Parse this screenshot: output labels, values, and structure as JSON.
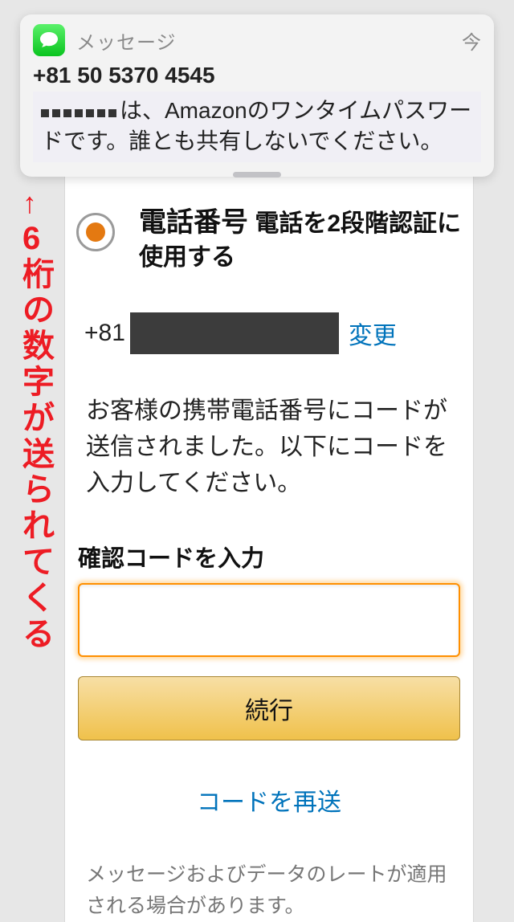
{
  "notification": {
    "app_name": "メッセージ",
    "time": "今",
    "from": "+81 50 5370 4545",
    "body_after_mask": "は、Amazonのワンタイムパスワードです。誰とも共有しないでください。"
  },
  "form": {
    "radio_label_bold": "電話番号",
    "radio_label_rest": " 電話を2段階認証に使用する",
    "phone_prefix": "+81",
    "change_link": "変更",
    "instruction": "お客様の携帯電話番号にコードが送信されました。以下にコードを入力してください。",
    "input_label": "確認コードを入力",
    "continue_label": "続行",
    "resend_label": "コードを再送",
    "disclaimer": "メッセージおよびデータのレートが適用される場合があります。"
  },
  "annotation": {
    "arrow": "↑",
    "text": "6桁の数字が送られてくる"
  }
}
